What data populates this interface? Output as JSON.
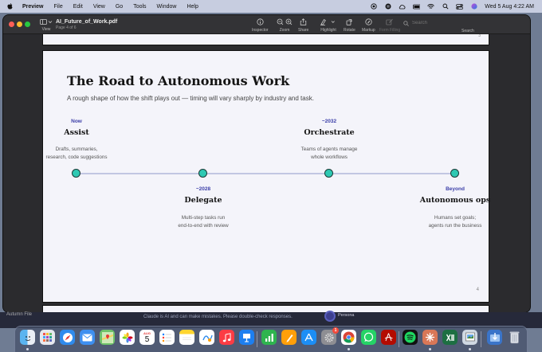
{
  "menubar": {
    "app_name": "Preview",
    "menus": [
      "File",
      "Edit",
      "View",
      "Go",
      "Tools",
      "Window",
      "Help"
    ],
    "clock": "Wed 5 Aug  4:22 AM"
  },
  "toolbar": {
    "view_label": "View",
    "doc_title": "AI_Future_of_Work.pdf",
    "doc_subtitle": "Page 4 of 6",
    "inspector_label": "Inspector",
    "zoom_label": "Zoom",
    "share_label": "Share",
    "highlight_label": "Highlight",
    "rotate_label": "Rotate",
    "markup_label": "Markup",
    "form_filling_label": "Form Filling",
    "search_placeholder": "Search",
    "search_label": "Search"
  },
  "document": {
    "prev_page_number": "3",
    "page_number": "4",
    "title": "The Road to Autonomous Work",
    "subtitle": "A rough shape of how the shift plays out — timing will vary sharply by industry and task.",
    "stages": [
      {
        "when": "Now",
        "name": "Assist",
        "desc_line1": "Drafts, summaries,",
        "desc_line2": "research, code suggestions"
      },
      {
        "when": "~2028",
        "name": "Delegate",
        "desc_line1": "Multi-step tasks run",
        "desc_line2": "end-to-end with review"
      },
      {
        "when": "~2032",
        "name": "Orchestrate",
        "desc_line1": "Teams of agents manage",
        "desc_line2": "whole workflows"
      },
      {
        "when": "Beyond",
        "name": "Autonomous ops",
        "desc_line1": "Humans set goals;",
        "desc_line2": "agents run the business"
      }
    ]
  },
  "background": {
    "notice": "Claude is AI and can make mistakes. Please double-check responses.",
    "left_text": "Autumn   File",
    "persona_label": "Persona"
  },
  "dock": {
    "calendar_month": "AUG",
    "calendar_day": "5",
    "settings_badge": "1",
    "icons": [
      "finder-icon",
      "launchpad-icon",
      "safari-icon",
      "mail-icon",
      "maps-icon",
      "photos-icon",
      "calendar-icon",
      "reminders-icon",
      "notes-icon",
      "freeform-icon",
      "music-icon",
      "keynote-icon",
      "numbers-icon",
      "pages-icon",
      "app-store-icon",
      "system-settings-icon",
      "chrome-icon",
      "whatsapp-icon",
      "acrobat-icon",
      "spotify-icon",
      "claude-icon",
      "excel-icon",
      "preview-icon",
      "downloads-icon",
      "trash-icon"
    ]
  }
}
